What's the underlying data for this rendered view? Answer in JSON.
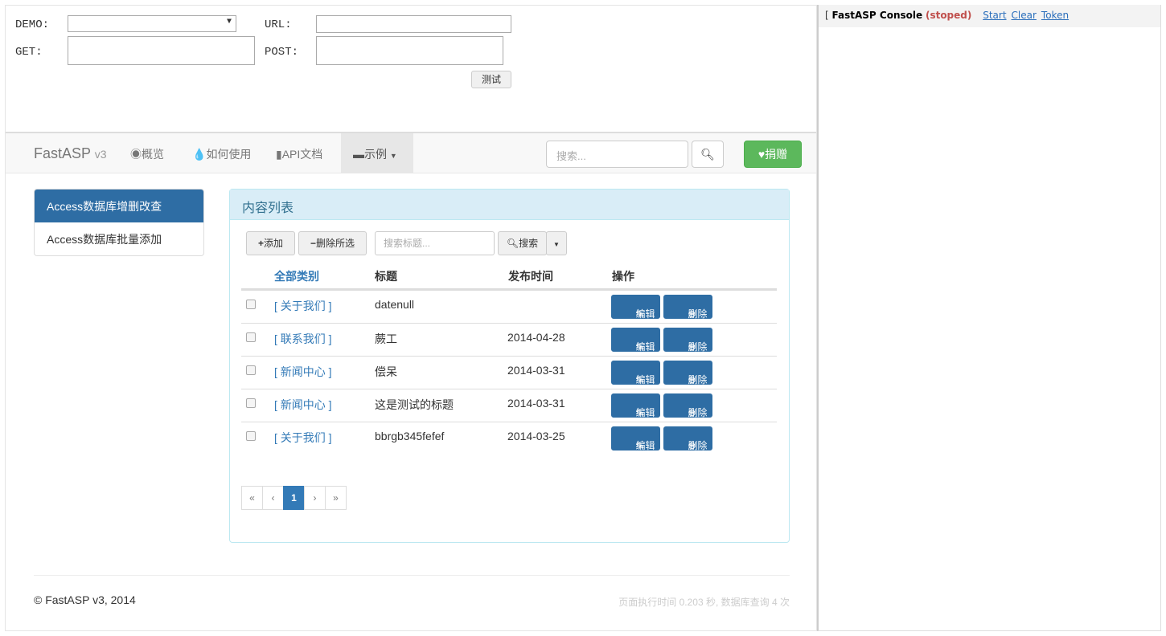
{
  "tester": {
    "demo_label": "DEMO:",
    "url_label": "URL:",
    "get_label": "GET:",
    "post_label": "POST:",
    "test_button": "测试"
  },
  "console": {
    "bracket": "[",
    "title": "FastASP Console",
    "status": "(stoped)",
    "start": "Start",
    "clear": "Clear",
    "token": "Token"
  },
  "navbar": {
    "brand": "FastASP",
    "version": "v3",
    "items": [
      "概览",
      "如何使用",
      "API文档",
      "示例"
    ],
    "search_placeholder": "搜索...",
    "donate": "捐赠"
  },
  "sidebar": {
    "items": [
      "Access数据库增删改查",
      "Access数据库批量添加"
    ]
  },
  "panel": {
    "title": "内容列表",
    "add": "添加",
    "delete_selected": "删除所选",
    "search_placeholder": "搜索标题...",
    "search": "搜索",
    "headers": [
      "全部类别",
      "标题",
      "发布时间",
      "操作"
    ],
    "rows": [
      {
        "category": "[ 关于我们 ]",
        "title": "datenull",
        "date": ""
      },
      {
        "category": "[ 联系我们 ]",
        "title": "蕨工",
        "date": "2014-04-28"
      },
      {
        "category": "[ 新闻中心 ]",
        "title": "偿呆",
        "date": "2014-03-31"
      },
      {
        "category": "[ 新闻中心 ]",
        "title": "这是测试的标题",
        "date": "2014-03-31"
      },
      {
        "category": "[ 关于我们 ]",
        "title": "bbrgb345fefef",
        "date": "2014-03-25"
      }
    ],
    "edit": "编辑",
    "delete": "删除",
    "pagination": [
      "«",
      "‹",
      "1",
      "›",
      "»"
    ]
  },
  "footer": {
    "copyright": "© FastASP v3, 2014",
    "stats": "页面执行时间 0.203 秒, 数据库查询 4 次"
  }
}
